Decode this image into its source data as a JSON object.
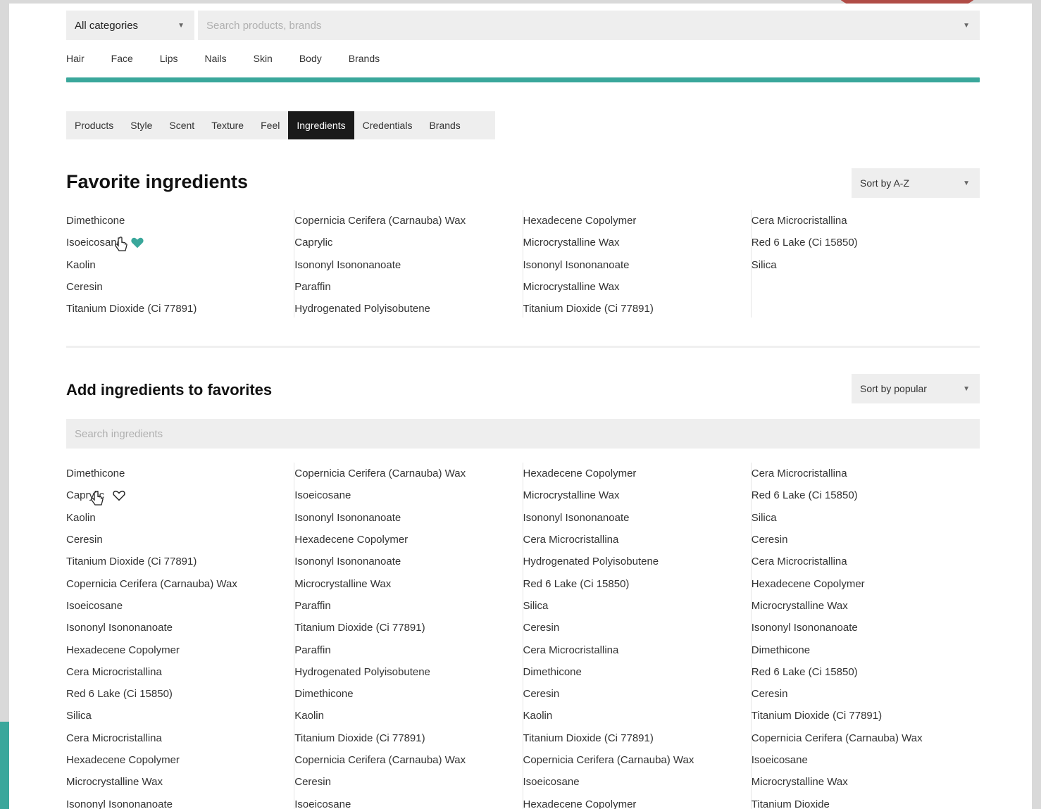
{
  "search": {
    "category": "All categories",
    "placeholder": "Search products, brands"
  },
  "main_nav": [
    "Hair",
    "Face",
    "Lips",
    "Nails",
    "Skin",
    "Body",
    "Brands"
  ],
  "sub_tabs": [
    {
      "label": "Products",
      "active": false
    },
    {
      "label": "Style",
      "active": false
    },
    {
      "label": "Scent",
      "active": false
    },
    {
      "label": "Texture",
      "active": false
    },
    {
      "label": "Feel",
      "active": false
    },
    {
      "label": "Ingredients",
      "active": true
    },
    {
      "label": "Credentials",
      "active": false
    },
    {
      "label": "Brands",
      "active": false
    }
  ],
  "favorites": {
    "title": "Favorite ingredients",
    "sort": "Sort by A-Z",
    "columns": [
      [
        "Dimethicone",
        "Isoeicosane",
        "Kaolin",
        "Ceresin",
        "Titanium Dioxide (Ci 77891)"
      ],
      [
        "Copernicia Cerifera (Carnauba) Wax",
        "Caprylic",
        "Isononyl Isononanoate",
        "Paraffin",
        "Hydrogenated Polyisobutene"
      ],
      [
        "Hexadecene Copolymer",
        "Microcrystalline Wax",
        "Isononyl Isononanoate",
        "Microcrystalline Wax",
        "Titanium Dioxide (Ci 77891)"
      ],
      [
        "Cera Microcristallina",
        "Red 6 Lake (Ci 15850)",
        "Silica"
      ]
    ]
  },
  "add": {
    "title": "Add ingredients to favorites",
    "sort": "Sort by popular",
    "search_placeholder": "Search ingredients",
    "columns": [
      [
        "Dimethicone",
        "Caprylic",
        "Kaolin",
        "Ceresin",
        "Titanium Dioxide (Ci 77891)",
        "Copernicia Cerifera (Carnauba) Wax",
        "Isoeicosane",
        "Isononyl Isononanoate",
        "Hexadecene Copolymer",
        "Cera Microcristallina",
        "Red 6 Lake (Ci 15850)",
        "Silica",
        "Cera Microcristallina",
        "Hexadecene Copolymer",
        "Microcrystalline Wax",
        "Isononyl Isononanoate"
      ],
      [
        "Copernicia Cerifera (Carnauba) Wax",
        "Isoeicosane",
        "Isononyl Isononanoate",
        "Hexadecene Copolymer",
        "Isononyl Isononanoate",
        "Microcrystalline Wax",
        "Paraffin",
        "Titanium Dioxide (Ci 77891)",
        "Paraffin",
        "Hydrogenated Polyisobutene",
        "Dimethicone",
        "Kaolin",
        "Titanium Dioxide (Ci 77891)",
        "Copernicia Cerifera (Carnauba) Wax",
        "Ceresin",
        "Isoeicosane"
      ],
      [
        "Hexadecene Copolymer",
        "Microcrystalline Wax",
        "Isononyl Isononanoate",
        "Cera Microcristallina",
        "Hydrogenated Polyisobutene",
        "Red 6 Lake (Ci 15850)",
        "Silica",
        "Ceresin",
        "Cera Microcristallina",
        "Dimethicone",
        "Ceresin",
        "Kaolin",
        "Titanium Dioxide (Ci 77891)",
        "Copernicia Cerifera (Carnauba) Wax",
        "Isoeicosane",
        "Hexadecene Copolymer"
      ],
      [
        "Cera Microcristallina",
        "Red 6 Lake (Ci 15850)",
        "Silica",
        "Ceresin",
        "Cera Microcristallina",
        "Hexadecene Copolymer",
        "Microcrystalline Wax",
        "Isononyl Isononanoate",
        "Dimethicone",
        "Red 6 Lake (Ci 15850)",
        "Ceresin",
        "Titanium Dioxide (Ci 77891)",
        "Copernicia Cerifera (Carnauba) Wax",
        "Isoeicosane",
        "Microcrystalline Wax",
        "Titanium Dioxide"
      ]
    ]
  },
  "colors": {
    "accent": "#3aa79b",
    "active_tab": "#1a1a1a",
    "field_bg": "#eeeeee"
  }
}
